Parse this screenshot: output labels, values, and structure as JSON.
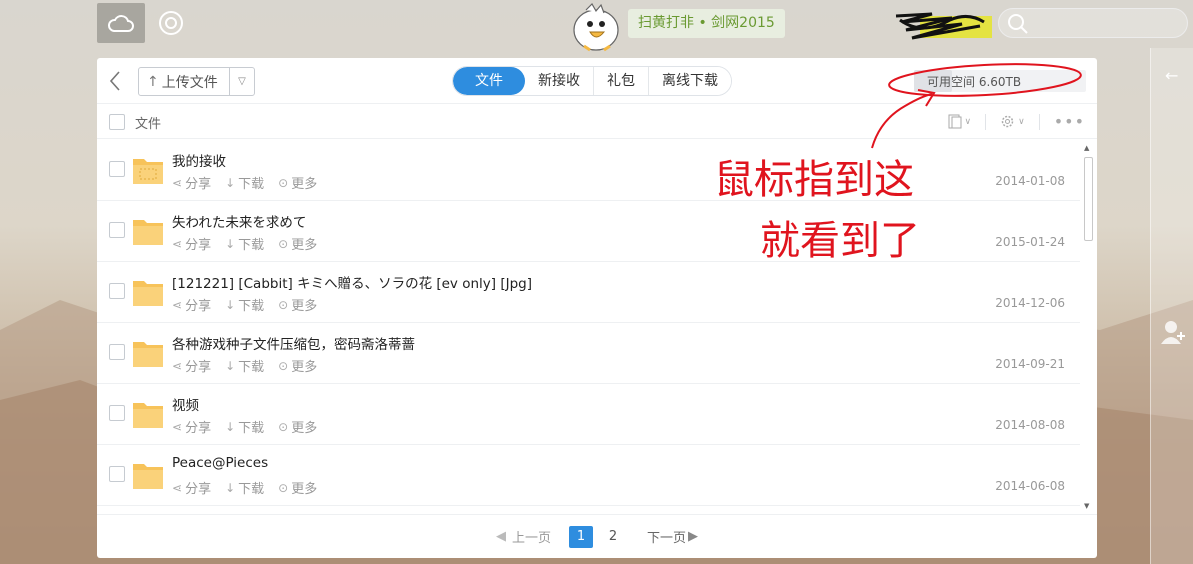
{
  "topbar": {
    "promo_text": "扫黄打非 • 剑网2015",
    "search_placeholder": ""
  },
  "toolbar": {
    "upload_label": "上传文件",
    "tabs": [
      {
        "label": "文件",
        "active": true
      },
      {
        "label": "新接收",
        "active": false
      },
      {
        "label": "礼包",
        "active": false
      },
      {
        "label": "离线下载",
        "active": false
      }
    ],
    "quota_text": "可用空间 6.60TB",
    "quota_used_fraction": 0.22
  },
  "header": {
    "file_label": "文件"
  },
  "actions": {
    "share": "分享",
    "download": "下载",
    "more": "更多"
  },
  "files": [
    {
      "name": "我的接收",
      "date": "2014-01-08"
    },
    {
      "name": "失われた未来を求めて",
      "date": "2015-01-24"
    },
    {
      "name": "[121221] [Cabbit] キミへ贈る、ソラの花 [ev only] [Jpg]",
      "date": "2014-12-06"
    },
    {
      "name": "各种游戏种子文件压缩包，密码斋洛蒂蔷",
      "date": "2014-09-21"
    },
    {
      "name": "视频",
      "date": "2014-08-08"
    },
    {
      "name": "Peace@Pieces",
      "date": "2014-06-08"
    }
  ],
  "pager": {
    "prev": "上一页",
    "pages": [
      "1",
      "2"
    ],
    "current": "1",
    "next": "下一页"
  },
  "annotation": {
    "line1": "鼠标指到这",
    "line2": "就看到了"
  },
  "colors": {
    "accent": "#2e8ddf",
    "promo_text": "#6a9a32",
    "annotation": "#e0141e",
    "folder": "#f7c35a"
  }
}
